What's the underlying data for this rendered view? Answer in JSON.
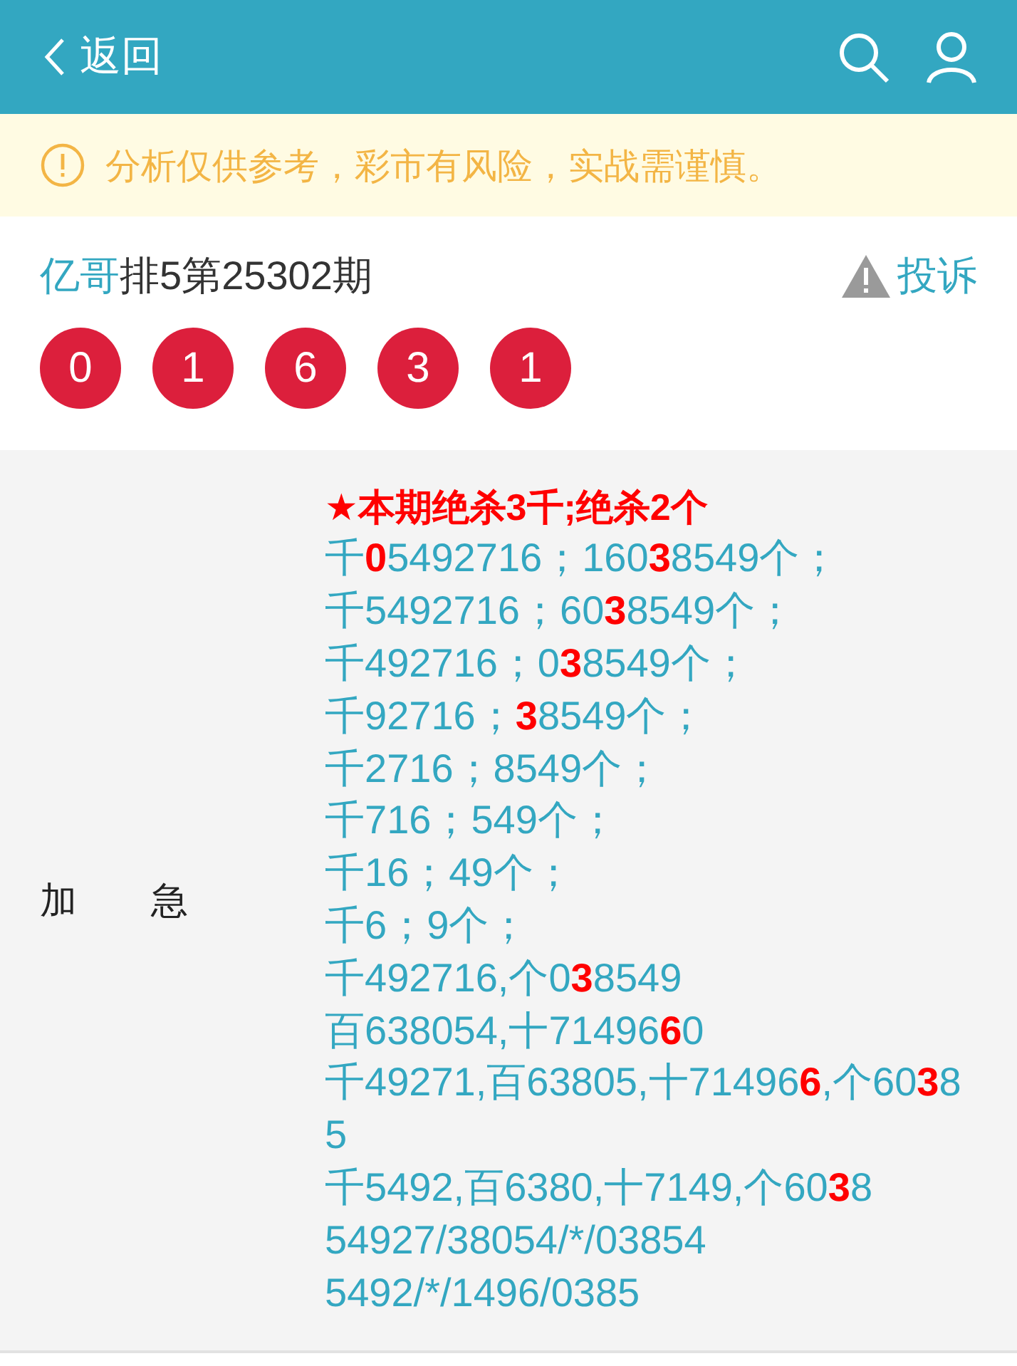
{
  "header": {
    "back_label": "返回"
  },
  "notice": {
    "text": "分析仅供参考，彩市有风险，实战需谨慎。"
  },
  "post": {
    "author": "亿哥",
    "title": "排5第25302期",
    "report_label": "投诉",
    "balls": [
      "0",
      "1",
      "6",
      "3",
      "1"
    ]
  },
  "analysis": {
    "label": "加　　急",
    "lines": [
      {
        "kind": "headline",
        "text": "★本期绝杀3千;绝杀2个"
      },
      {
        "kind": "code",
        "text": "千**0**5492716；160**3**8549个；"
      },
      {
        "kind": "code",
        "text": "千5492716；60**3**8549个；"
      },
      {
        "kind": "code",
        "text": "千492716；0**3**8549个；"
      },
      {
        "kind": "code",
        "text": "千92716；**3**8549个；"
      },
      {
        "kind": "code",
        "text": "千2716；8549个；"
      },
      {
        "kind": "code",
        "text": "千716；549个；"
      },
      {
        "kind": "code",
        "text": "千16；49个；"
      },
      {
        "kind": "code",
        "text": "千6；9个；"
      },
      {
        "kind": "code",
        "text": "千492716,个0**3**8549"
      },
      {
        "kind": "code",
        "text": "百638054,十71496**6**0"
      },
      {
        "kind": "code",
        "text": "千49271,百63805,十71496**6**,个60**3**85"
      },
      {
        "kind": "code",
        "text": "千5492,百6380,十7149,个60**3**8"
      },
      {
        "kind": "code",
        "text": "54927/38054/*/03854"
      },
      {
        "kind": "code",
        "text": "5492/*/1496/0385"
      }
    ]
  }
}
